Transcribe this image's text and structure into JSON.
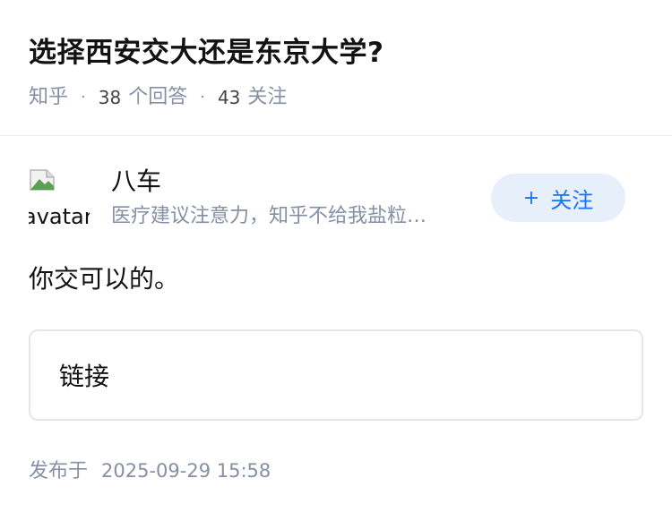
{
  "question": {
    "title": "选择西安交大还是东京大学?",
    "source": "知乎",
    "answer_count": "38",
    "answer_label": "个回答",
    "follow_count": "43",
    "follow_label": "关注"
  },
  "author": {
    "avatar_alt": "avatar",
    "name": "八车",
    "bio": "医疗建议注意力，知乎不给我盐粒…",
    "follow_button_label": "关注",
    "follow_button_icon": "plus-icon"
  },
  "answer": {
    "content": "你交可以的。",
    "link_card_label": "链接",
    "publish_prefix": "发布于",
    "publish_time": "2025-09-29 15:58"
  },
  "colors": {
    "accent": "#1772f6",
    "button_bg": "#e7f0fa",
    "meta_gray": "#8590a6"
  }
}
